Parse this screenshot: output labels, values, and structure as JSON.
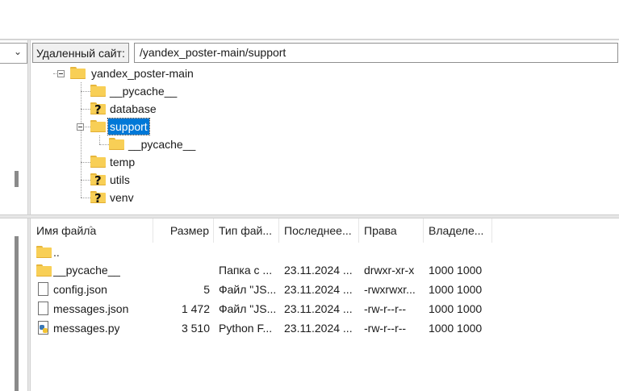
{
  "remote_site": {
    "label": "Удаленный сайт:",
    "path": "/yandex_poster-main/support"
  },
  "tree": {
    "root": "yandex_poster-main",
    "items": [
      {
        "label": "__pycache__",
        "icon": "folder-icon"
      },
      {
        "label": "database",
        "icon": "folder-unknown-icon"
      },
      {
        "label": "support",
        "icon": "folder-icon",
        "selected": true
      },
      {
        "label": "__pycache__",
        "icon": "folder-icon"
      },
      {
        "label": "temp",
        "icon": "folder-icon"
      },
      {
        "label": "utils",
        "icon": "folder-unknown-icon"
      },
      {
        "label": "venv",
        "icon": "folder-unknown-icon"
      }
    ]
  },
  "file_list": {
    "columns": [
      "Имя файла",
      "Размер",
      "Тип фай...",
      "Последнее...",
      "Права",
      "Владеле..."
    ],
    "rows": [
      {
        "name": "..",
        "size": "",
        "type": "",
        "modified": "",
        "perms": "",
        "owner": "",
        "icon": "folder-icon"
      },
      {
        "name": "__pycache__",
        "size": "",
        "type": "Папка с ...",
        "modified": "23.11.2024 ...",
        "perms": "drwxr-xr-x",
        "owner": "1000 1000",
        "icon": "folder-icon"
      },
      {
        "name": "config.json",
        "size": "5",
        "type": "Файл \"JS...",
        "modified": "23.11.2024 ...",
        "perms": "-rwxrwxr...",
        "owner": "1000 1000",
        "icon": "file-icon"
      },
      {
        "name": "messages.json",
        "size": "1 472",
        "type": "Файл \"JS...",
        "modified": "23.11.2024 ...",
        "perms": "-rw-r--r--",
        "owner": "1000 1000",
        "icon": "file-icon"
      },
      {
        "name": "messages.py",
        "size": "3 510",
        "type": "Python F...",
        "modified": "23.11.2024 ...",
        "perms": "-rw-r--r--",
        "owner": "1000 1000",
        "icon": "python-file-icon"
      }
    ]
  },
  "colors": {
    "selection": "#0078d7",
    "folder": "#f8cf56"
  }
}
